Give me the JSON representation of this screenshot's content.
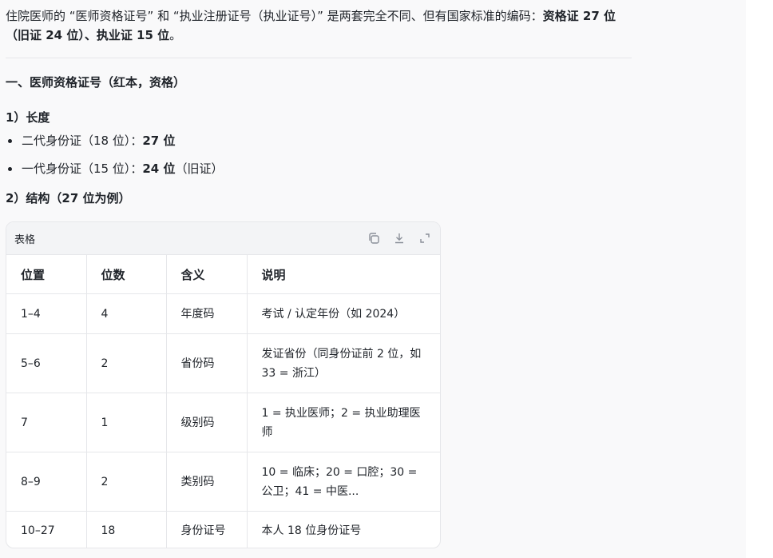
{
  "intro": {
    "part1": "住院医师的 “医师资格证号” 和 “执业注册证号（执业证号）” 是两套完全不同、但有国家标准的编码：",
    "bold1": "资格证 27 位（旧证 24 位）、执业证 15 位",
    "end": "。"
  },
  "section1": {
    "title": "一、医师资格证号（红本，资格）",
    "length_heading": "1）长度",
    "bullets": [
      {
        "text": "二代身份证（18 位）：",
        "bold": "27 位",
        "suffix": ""
      },
      {
        "text": "一代身份证（15 位）：",
        "bold": "24 位",
        "suffix": "（旧证）"
      }
    ],
    "structure_heading": "2）结构（27 位为例）"
  },
  "table": {
    "label": "表格",
    "actions": [
      "copy-icon",
      "download-icon",
      "expand-icon"
    ],
    "headers": [
      "位置",
      "位数",
      "含义",
      "说明"
    ],
    "rows": [
      [
        "1–4",
        "4",
        "年度码",
        "考试 / 认定年份（如 2024）"
      ],
      [
        "5–6",
        "2",
        "省份码",
        "发证省份（同身份证前 2 位，如 33 = 浙江）"
      ],
      [
        "7",
        "1",
        "级别码",
        "1 = 执业医师；2 = 执业助理医师"
      ],
      [
        "8–9",
        "2",
        "类别码",
        "10 = 临床；20 = 口腔；30 = 公卫；41 = 中医..."
      ],
      [
        "10–27",
        "18",
        "身份证号",
        "本人 18 位身份证号"
      ]
    ]
  }
}
